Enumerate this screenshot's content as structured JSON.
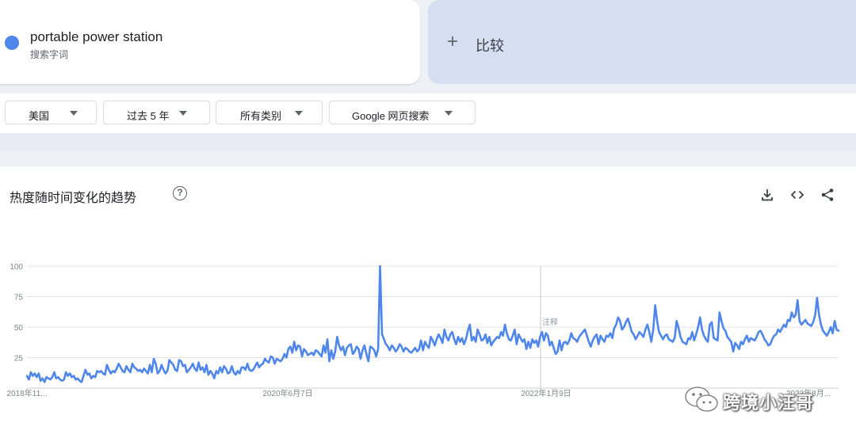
{
  "search_term": {
    "name": "portable power station",
    "subtitle": "搜索字词",
    "color": "#4f86ea"
  },
  "compare": {
    "plus": "+",
    "label": "比较"
  },
  "filters": [
    {
      "label": "美国"
    },
    {
      "label": "过去 5 年"
    },
    {
      "label": "所有类别"
    },
    {
      "label": "Google 网页搜索"
    }
  ],
  "chart_section": {
    "title": "热度随时间变化的趋势",
    "help_icon": "help-circle-icon",
    "toolbar": [
      "download-icon",
      "embed-code-icon",
      "share-icon"
    ]
  },
  "chart_data": {
    "type": "line",
    "ylim": [
      0,
      100
    ],
    "y_ticks": [
      100,
      75,
      50,
      25
    ],
    "x_tick_labels": [
      "2018年11...",
      "2020年6月7日",
      "2022年1月9日",
      "2023年8月..."
    ],
    "annotation": "注释",
    "grid": true,
    "series": [
      {
        "color": "#4f86ea",
        "values": [
          10,
          7,
          13,
          10,
          12,
          9,
          12,
          6,
          8,
          5,
          9,
          8,
          7,
          9,
          13,
          8,
          9,
          7,
          6,
          7,
          13,
          10,
          12,
          9,
          10,
          7,
          8,
          6,
          5,
          10,
          15,
          11,
          12,
          8,
          10,
          9,
          14,
          13,
          14,
          12,
          11,
          19,
          15,
          12,
          14,
          13,
          16,
          20,
          17,
          14,
          13,
          18,
          15,
          13,
          20,
          17,
          16,
          14,
          15,
          13,
          16,
          14,
          12,
          19,
          13,
          24,
          20,
          12,
          14,
          19,
          15,
          12,
          14,
          23,
          21,
          19,
          15,
          14,
          23,
          22,
          18,
          19,
          13,
          15,
          17,
          20,
          16,
          14,
          21,
          15,
          17,
          13,
          19,
          11,
          14,
          12,
          8,
          14,
          12,
          17,
          13,
          18,
          16,
          12,
          13,
          18,
          13,
          11,
          14,
          12,
          17,
          17,
          15,
          20,
          15,
          14,
          15,
          18,
          21,
          17,
          19,
          20,
          24,
          22,
          21,
          26,
          25,
          20,
          24,
          23,
          22,
          24,
          28,
          25,
          32,
          34,
          29,
          38,
          31,
          35,
          34,
          26,
          32,
          30,
          27,
          28,
          29,
          27,
          31,
          30,
          28,
          26,
          35,
          29,
          40,
          22,
          31,
          24,
          30,
          42,
          35,
          31,
          34,
          27,
          33,
          35,
          36,
          28,
          30,
          34,
          32,
          24,
          31,
          35,
          28,
          22,
          34,
          33,
          31,
          26,
          32,
          100,
          44,
          40,
          36,
          34,
          31,
          35,
          33,
          30,
          32,
          36,
          34,
          30,
          33,
          32,
          30,
          29,
          31,
          33,
          30,
          32,
          39,
          31,
          38,
          35,
          33,
          42,
          39,
          35,
          40,
          44,
          41,
          37,
          48,
          42,
          39,
          44,
          46,
          40,
          36,
          42,
          38,
          41,
          36,
          40,
          47,
          52,
          39,
          42,
          38,
          48,
          44,
          39,
          40,
          44,
          37,
          42,
          35,
          38,
          40,
          42,
          41,
          46,
          43,
          52,
          45,
          40,
          39,
          43,
          48,
          36,
          44,
          41,
          38,
          40,
          32,
          38,
          33,
          40,
          37,
          39,
          34,
          42,
          46,
          39,
          45,
          43,
          35,
          38,
          33,
          28,
          30,
          39,
          31,
          37,
          38,
          36,
          39,
          45,
          41,
          40,
          38,
          42,
          44,
          46,
          48,
          43,
          38,
          34,
          39,
          42,
          44,
          36,
          43,
          40,
          38,
          43,
          42,
          45,
          41,
          49,
          52,
          58,
          55,
          48,
          50,
          54,
          57,
          52,
          46,
          44,
          40,
          43,
          46,
          44,
          42,
          48,
          52,
          46,
          38,
          48,
          68,
          55,
          46,
          43,
          40,
          43,
          44,
          40,
          39,
          38,
          41,
          55,
          49,
          42,
          38,
          37,
          36,
          41,
          40,
          46,
          39,
          44,
          50,
          58,
          48,
          43,
          40,
          38,
          52,
          54,
          41,
          40,
          39,
          62,
          55,
          49,
          47,
          42,
          40,
          38,
          30,
          37,
          35,
          32,
          38,
          36,
          40,
          43,
          38,
          41,
          40,
          39,
          42,
          46,
          47,
          44,
          40,
          38,
          35,
          36,
          40,
          43,
          44,
          48,
          46,
          49,
          52,
          50,
          56,
          55,
          62,
          58,
          60,
          72,
          55,
          52,
          54,
          56,
          53,
          52,
          51,
          54,
          60,
          74,
          60,
          52,
          47,
          45,
          43,
          46,
          50,
          45,
          55,
          48,
          47
        ]
      }
    ]
  },
  "watermark": {
    "text": "跨境小汪哥"
  }
}
